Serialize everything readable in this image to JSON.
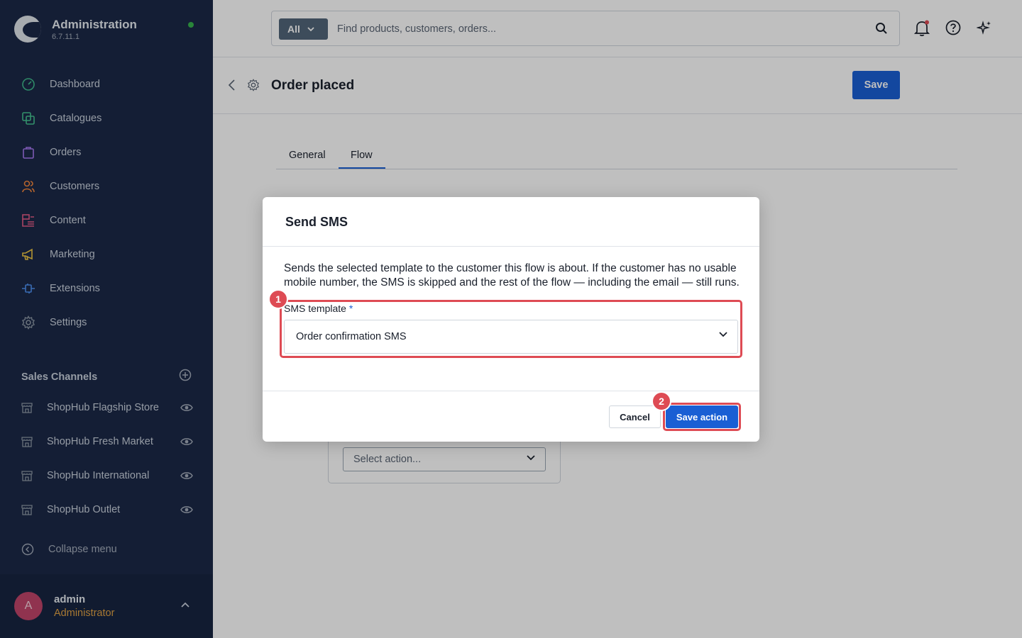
{
  "brand": {
    "title": "Administration",
    "version": "6.7.11.1"
  },
  "nav": {
    "items": [
      {
        "label": "Dashboard",
        "icon": "dashboard-icon",
        "color": "#3fb98b"
      },
      {
        "label": "Catalogues",
        "icon": "catalogue-icon",
        "color": "#45c18f"
      },
      {
        "label": "Orders",
        "icon": "bag-icon",
        "color": "#a677f0"
      },
      {
        "label": "Customers",
        "icon": "users-icon",
        "color": "#f0853d"
      },
      {
        "label": "Content",
        "icon": "content-icon",
        "color": "#e25a86"
      },
      {
        "label": "Marketing",
        "icon": "megaphone-icon",
        "color": "#ecc443"
      },
      {
        "label": "Extensions",
        "icon": "plugin-icon",
        "color": "#4d8ff0"
      },
      {
        "label": "Settings",
        "icon": "gear-icon",
        "color": "#8c97a5"
      }
    ]
  },
  "sales_channels": {
    "title": "Sales Channels",
    "items": [
      {
        "label": "ShopHub Flagship Store"
      },
      {
        "label": "ShopHub Fresh Market"
      },
      {
        "label": "ShopHub International"
      },
      {
        "label": "ShopHub Outlet"
      }
    ]
  },
  "collapse_label": "Collapse menu",
  "user": {
    "initial": "A",
    "name": "admin",
    "role": "Administrator"
  },
  "search": {
    "scope": "All",
    "placeholder": "Find products, customers, orders..."
  },
  "header": {
    "title": "Order placed",
    "save_label": "Save"
  },
  "tabs": [
    {
      "label": "General"
    },
    {
      "label": "Flow",
      "active": true
    }
  ],
  "flow_card": {
    "select_placeholder": "Select action..."
  },
  "modal": {
    "title": "Send SMS",
    "description": "Sends the selected template to the customer this flow is about. If the customer has no usable mobile number, the SMS is skipped and the rest of the flow — including the email — still runs.",
    "field_label": "SMS template",
    "required_mark": "*",
    "field_value": "Order confirmation SMS",
    "cancel_label": "Cancel",
    "save_label": "Save action"
  },
  "annotations": {
    "step1": "1",
    "step2": "2"
  },
  "colors": {
    "sidebar": "#1b2947",
    "primary": "#1a5fd4",
    "highlight": "#de4b54",
    "status_dot": "#37b24d"
  }
}
